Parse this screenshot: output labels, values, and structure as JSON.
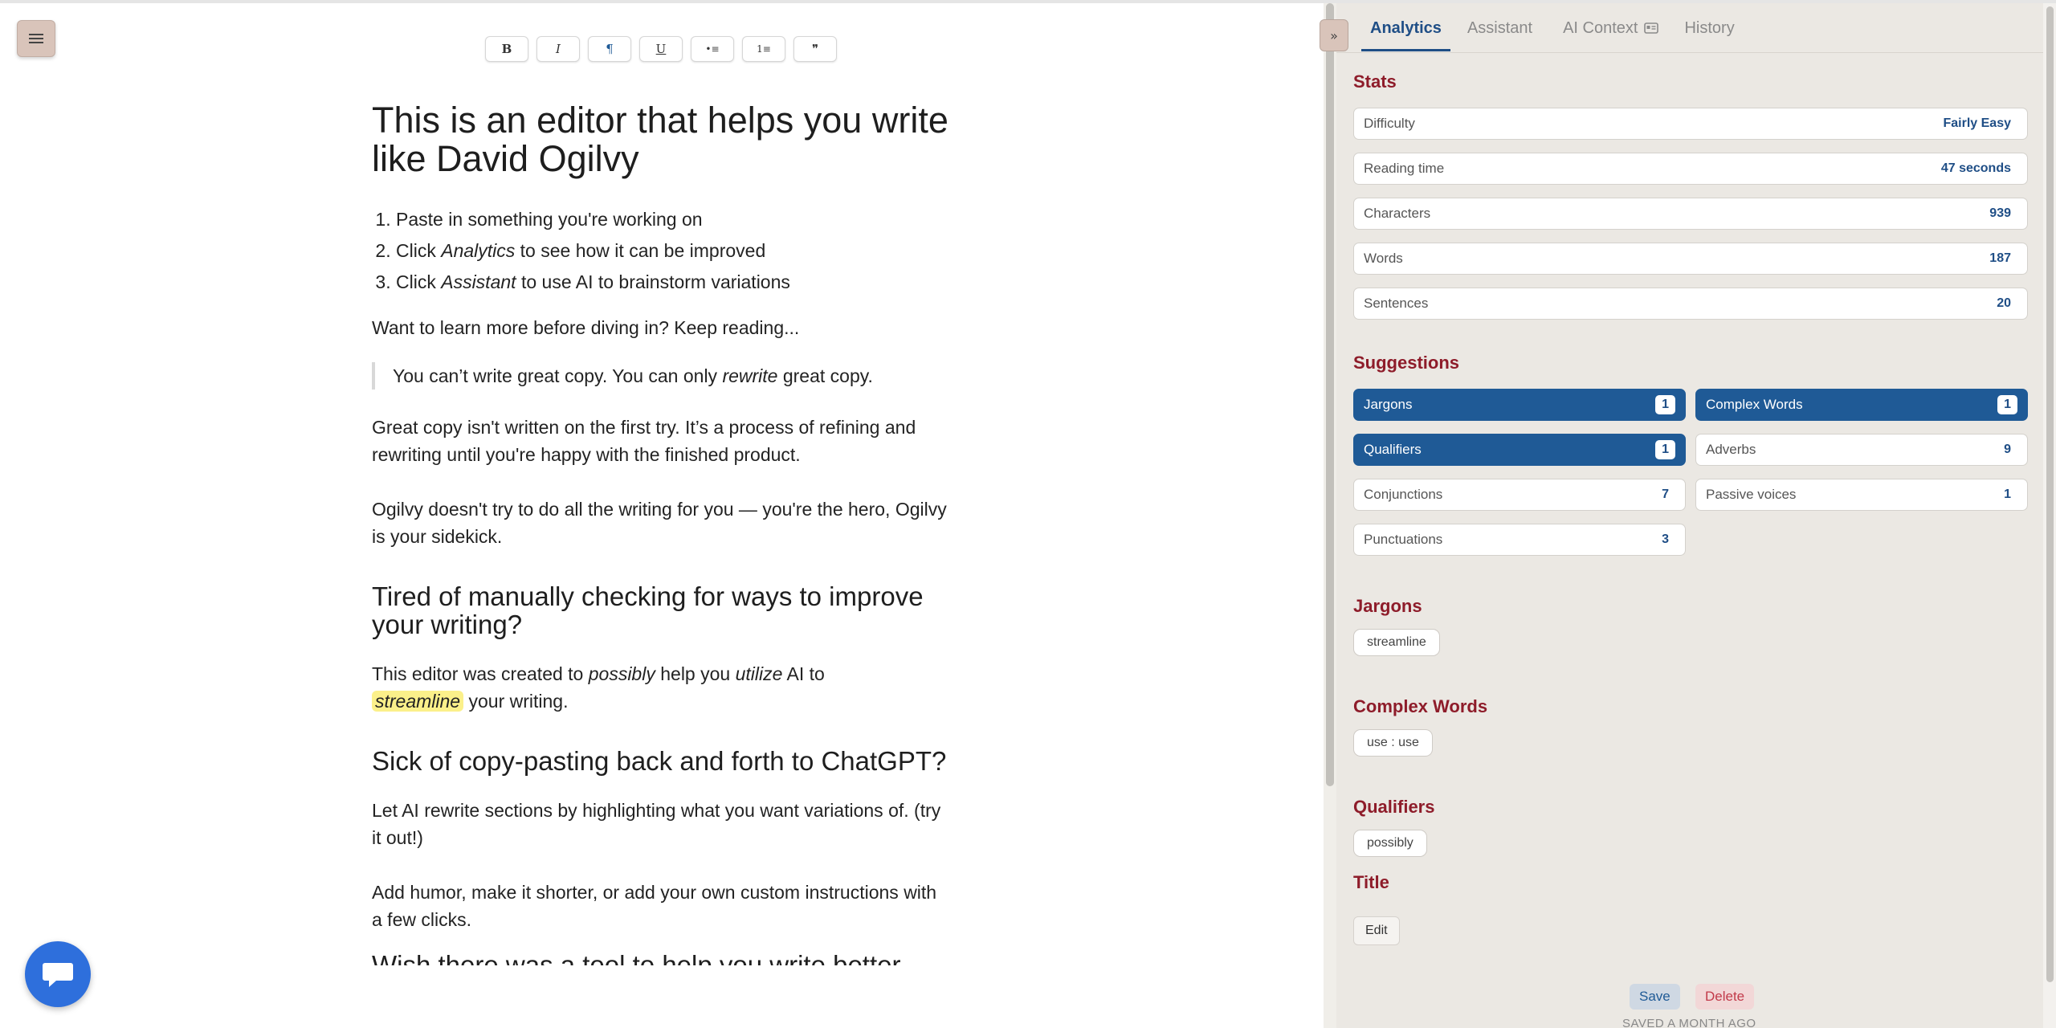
{
  "toolbar": {
    "bold": "B",
    "italic": "I",
    "paragraph": "¶",
    "underline": "U",
    "bullet_list": "•≡",
    "numbered_list": "1≡",
    "quote": "❞"
  },
  "editor": {
    "title": "This is an editor that helps you write like David Ogilvy",
    "steps": [
      {
        "pre": "Paste in something you're working on",
        "em": "",
        "post": ""
      },
      {
        "pre": "Click ",
        "em": "Analytics",
        "post": " to see how it can be improved"
      },
      {
        "pre": "Click ",
        "em": "Assistant",
        "post": " to use AI to brainstorm variations"
      }
    ],
    "p_learn": "Want to learn more before diving in? Keep reading...",
    "quote": {
      "pre": "You can’t write great copy. You can only ",
      "em": "rewrite",
      "post": " great copy."
    },
    "p_great": "Great copy isn't written on the first try. It’s a process of refining and rewriting until you're happy with the finished product.",
    "p_ogilvy": "Ogilvy doesn't try to do all the writing for you — you're the hero, Ogilvy is your sidekick.",
    "h2_tired": "Tired of manually checking for ways to improve your writing?",
    "p_created": {
      "a": "This editor was created to ",
      "b": "possibly",
      "c": " help you ",
      "d": "utilize",
      "e": " AI to ",
      "f": "streamline",
      "g": " your writing."
    },
    "h2_sick": "Sick of copy-pasting back and forth to ChatGPT?",
    "p_rewrite": "Let AI rewrite sections by highlighting what you want variations of. (try it out!)",
    "p_humor": "Add humor, make it shorter, or add your own custom instructions with a few clicks.",
    "h2_partial": "Wish there was a tool to help you write better"
  },
  "panel": {
    "collapse": "»",
    "tabs": [
      "Analytics",
      "Assistant",
      "AI Context",
      "History"
    ],
    "stats_title": "Stats",
    "stats": [
      {
        "label": "Difficulty",
        "value": "Fairly Easy"
      },
      {
        "label": "Reading time",
        "value": "47 seconds"
      },
      {
        "label": "Characters",
        "value": "939"
      },
      {
        "label": "Words",
        "value": "187"
      },
      {
        "label": "Sentences",
        "value": "20"
      }
    ],
    "suggestions_title": "Suggestions",
    "suggestions": [
      {
        "label": "Jargons",
        "count": "1",
        "selected": true
      },
      {
        "label": "Complex Words",
        "count": "1",
        "selected": true
      },
      {
        "label": "Qualifiers",
        "count": "1",
        "selected": true
      },
      {
        "label": "Adverbs",
        "count": "9",
        "selected": false
      },
      {
        "label": "Conjunctions",
        "count": "7",
        "selected": false
      },
      {
        "label": "Passive voices",
        "count": "1",
        "selected": false
      },
      {
        "label": "Punctuations",
        "count": "3",
        "selected": false
      }
    ],
    "jargons_title": "Jargons",
    "jargons_chip": "streamline",
    "complex_title": "Complex Words",
    "complex_chip": "use : use",
    "qualifiers_title": "Qualifiers",
    "qualifiers_chip": "possibly",
    "title_title": "Title",
    "edit": "Edit",
    "save": "Save",
    "delete": "Delete",
    "saved": "SAVED A MONTH AGO"
  },
  "colors": {
    "accent": "#1f5a96",
    "heading_red": "#8e1c2a",
    "panel_bg": "#ebe8e3",
    "highlight": "#fbf08a",
    "chat_blue": "#2e6fdc"
  }
}
